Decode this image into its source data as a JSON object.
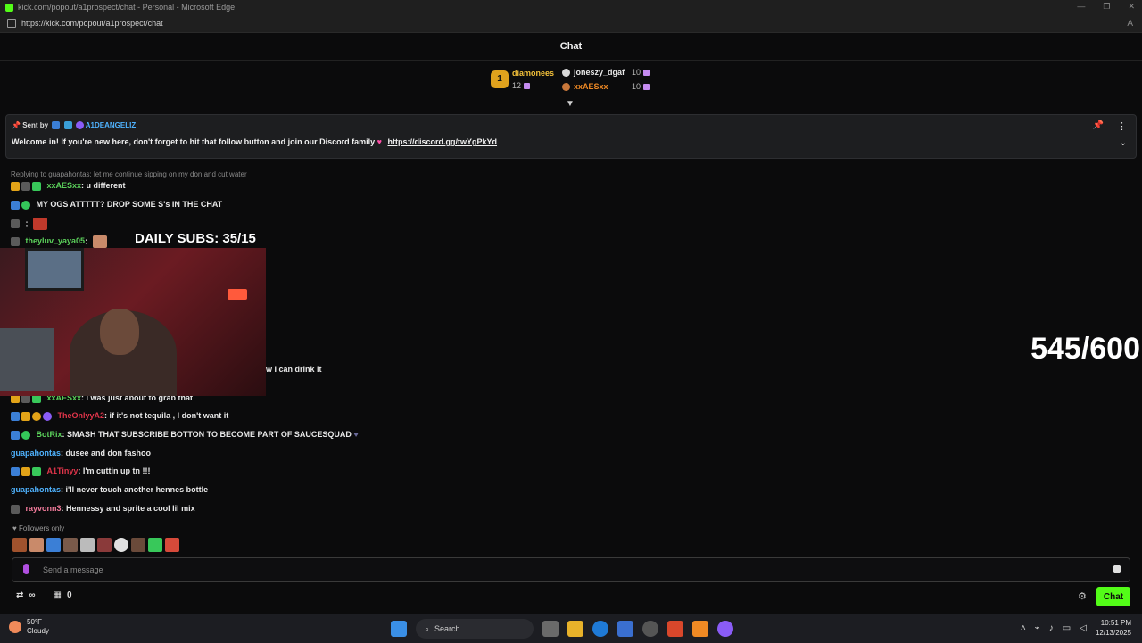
{
  "browser": {
    "window_title": "kick.com/popout/a1prospect/chat - Personal - Microsoft Edge",
    "url": "https://kick.com/popout/a1prospect/chat"
  },
  "chat": {
    "header": "Chat",
    "leaderboard": {
      "first": {
        "rank": "1",
        "name": "diamonees",
        "count": "12"
      },
      "second": {
        "name": "joneszy_dgaf",
        "count": "10"
      },
      "third": {
        "name": "xxAESxx",
        "count": "10"
      }
    },
    "pinned": {
      "sent_by_label": "Sent by",
      "sender": "A1DEANGELIZ",
      "message": "Welcome in! If you're new here, don't forget to hit that follow button and join our Discord family",
      "link": "https://discord.gg/twYgPkYd"
    },
    "messages": [
      {
        "reply": "Replying to guapahontas: let me continue sipping on my don and cut water"
      },
      {
        "user": "xxAESxx",
        "user_color": "#5bd15b",
        "text": ": u different"
      },
      {
        "user": "",
        "text": " MY OGS ATTTTT? DROP SOME S's IN THE CHAT"
      },
      {
        "user": "",
        "user_color": "#e04a4a",
        "text": ":"
      },
      {
        "user": "theyluv_yaya05",
        "user_color": "#5bd15b",
        "text": ":"
      },
      {
        "user": "",
        "text": "w I can drink it"
      },
      {
        "user": "xxAESxx",
        "user_color": "#5bd15b",
        "text": ": I was just about to grab that"
      },
      {
        "user": "TheOnlyyA2",
        "user_color": "#e0344a",
        "text": ": if it's not tequila , I don't want it"
      },
      {
        "user": "BotRix",
        "user_color": "#5bd15b",
        "text": ": SMASH THAT SUBSCRIBE BOTTON TO BECOME PART OF SAUCESQUAD"
      },
      {
        "user": "guapahontas",
        "user_color": "#4fb3ff",
        "text": ": dusee and don fashoo"
      },
      {
        "user": "A1Tinyy",
        "user_color": "#e0344a",
        "text": ": I'm cuttin up tn !!!"
      },
      {
        "user": "guapahontas",
        "user_color": "#4fb3ff",
        "text": ": i'll never touch another hennes bottle"
      },
      {
        "user": "rayvonn3",
        "user_color": "#f07a9a",
        "text": ": Hennessy and sprite a cool lil mix"
      }
    ],
    "followers_only": "Followers only",
    "input_placeholder": "Send a message",
    "bottom_left_count": "0",
    "send_button": "Chat"
  },
  "overlay": {
    "daily_subs": "DAILY SUBS: 35/15",
    "goal_counter": "545/600"
  },
  "taskbar": {
    "temperature": "50°F",
    "condition": "Cloudy",
    "search": "Search",
    "time": "10:51 PM",
    "date": "12/13/2025"
  },
  "colors": {
    "kick_green": "#53fc18",
    "background": "#0b0b0c"
  }
}
